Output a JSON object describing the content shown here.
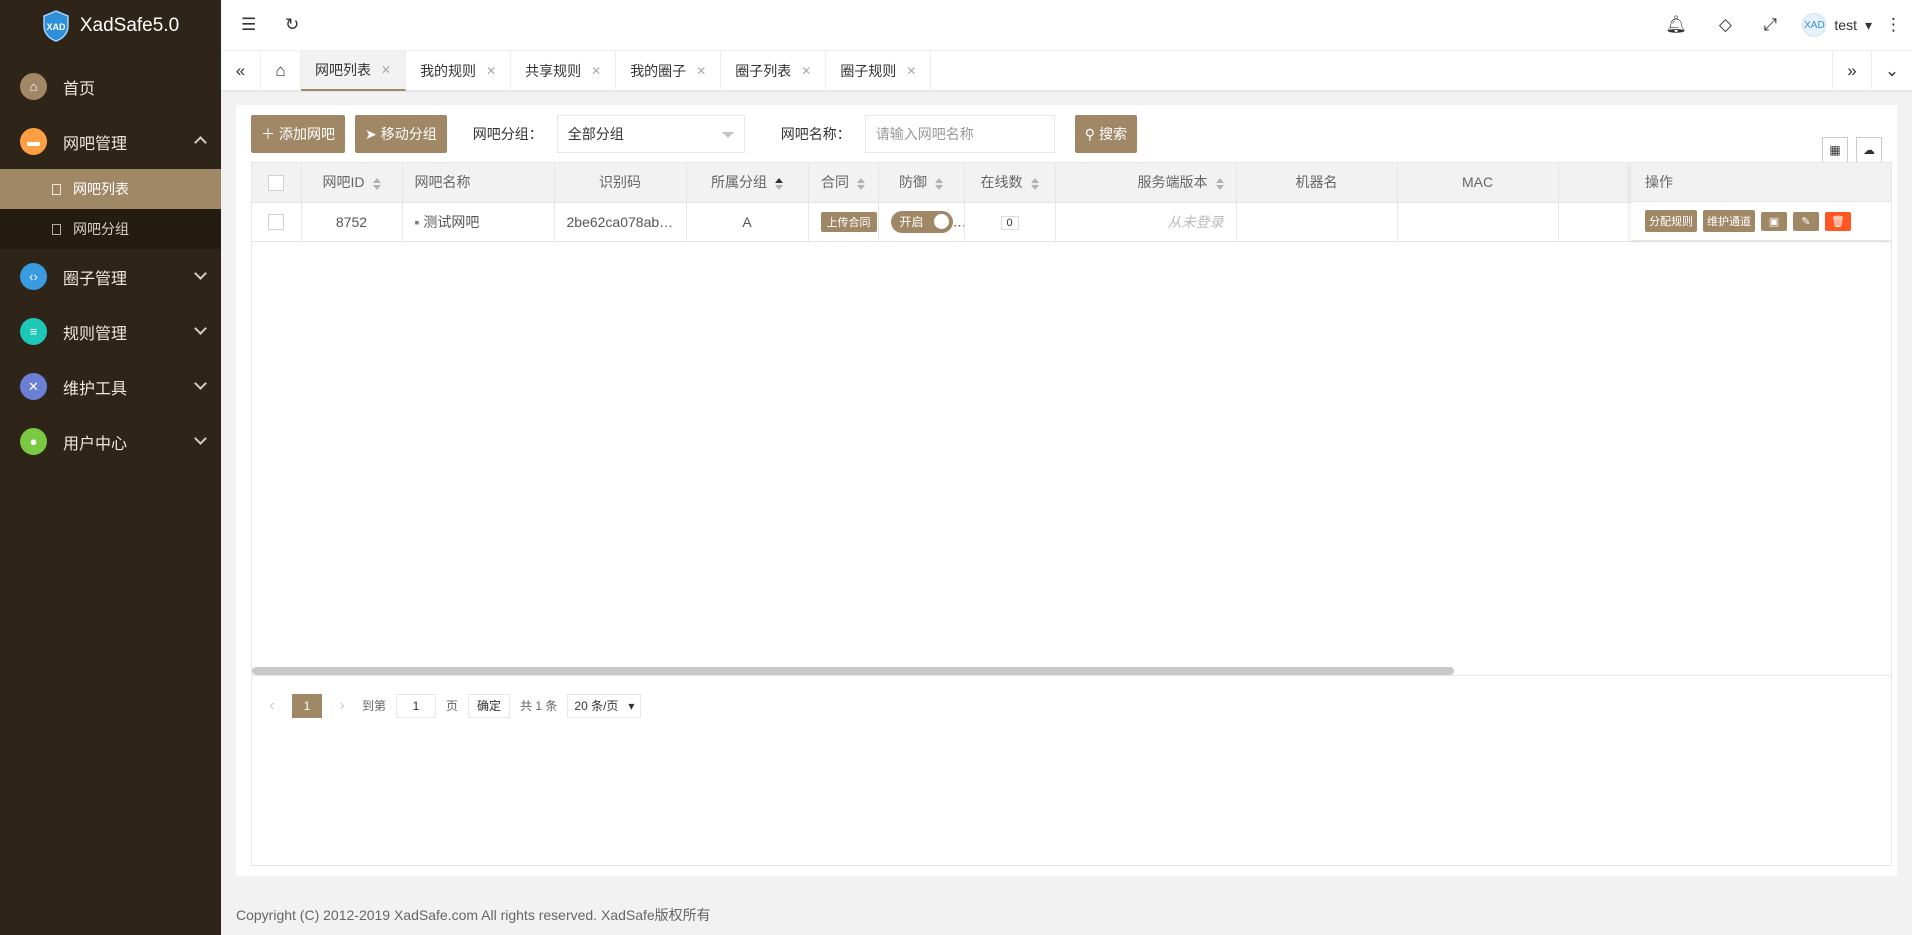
{
  "app": {
    "title": "XadSafe5.0"
  },
  "sidebar": {
    "items": [
      {
        "label": "首页",
        "icon": "home-icon",
        "color": "#a08866"
      },
      {
        "label": "网吧管理",
        "icon": "chat-icon",
        "color": "#ff9f43",
        "expanded": true,
        "children": [
          {
            "label": "网吧列表",
            "active": true
          },
          {
            "label": "网吧分组",
            "active": false
          }
        ]
      },
      {
        "label": "圈子管理",
        "icon": "code-icon",
        "color": "#3a9be0"
      },
      {
        "label": "规则管理",
        "icon": "file-icon",
        "color": "#1ec8b8"
      },
      {
        "label": "维护工具",
        "icon": "tools-icon",
        "color": "#6b7fd7"
      },
      {
        "label": "用户中心",
        "icon": "user-icon",
        "color": "#7ac943"
      }
    ]
  },
  "header": {
    "user": "test"
  },
  "tabs": [
    {
      "label": "网吧列表",
      "active": true
    },
    {
      "label": "我的规则"
    },
    {
      "label": "共享规则"
    },
    {
      "label": "我的圈子"
    },
    {
      "label": "圈子列表"
    },
    {
      "label": "圈子规则"
    }
  ],
  "toolbar": {
    "add_label": "添加网吧",
    "move_label": "移动分组",
    "group_label": "网吧分组：",
    "group_value": "全部分组",
    "name_label": "网吧名称：",
    "name_placeholder": "请输入网吧名称",
    "search_label": "搜索"
  },
  "table": {
    "columns": [
      "网吧ID",
      "网吧名称",
      "识别码",
      "所属分组",
      "合同",
      "防御",
      "在线数",
      "服务端版本",
      "机器名",
      "MAC",
      "操作"
    ],
    "rows": [
      {
        "id": "8752",
        "name": "测试网吧",
        "code": "2be62ca078ab5a...",
        "group": "A",
        "contract": "上传合同",
        "defense": "开启",
        "online": "0",
        "version": "从未登录",
        "machine": "",
        "mac": ""
      }
    ],
    "actions": {
      "assign": "分配规则",
      "maintain": "维护通道"
    }
  },
  "pager": {
    "current": "1",
    "goto_label": "到第",
    "page_value": "1",
    "page_unit": "页",
    "confirm": "确定",
    "total": "共 1 条",
    "per_page": "20 条/页"
  },
  "footer": {
    "text": "Copyright (C) 2012-2019 XadSafe.com All rights reserved. XadSafe版权所有"
  },
  "colors": {
    "accent": "#a08866",
    "sidebar_bg": "#2e2418",
    "danger": "#ff5722"
  }
}
